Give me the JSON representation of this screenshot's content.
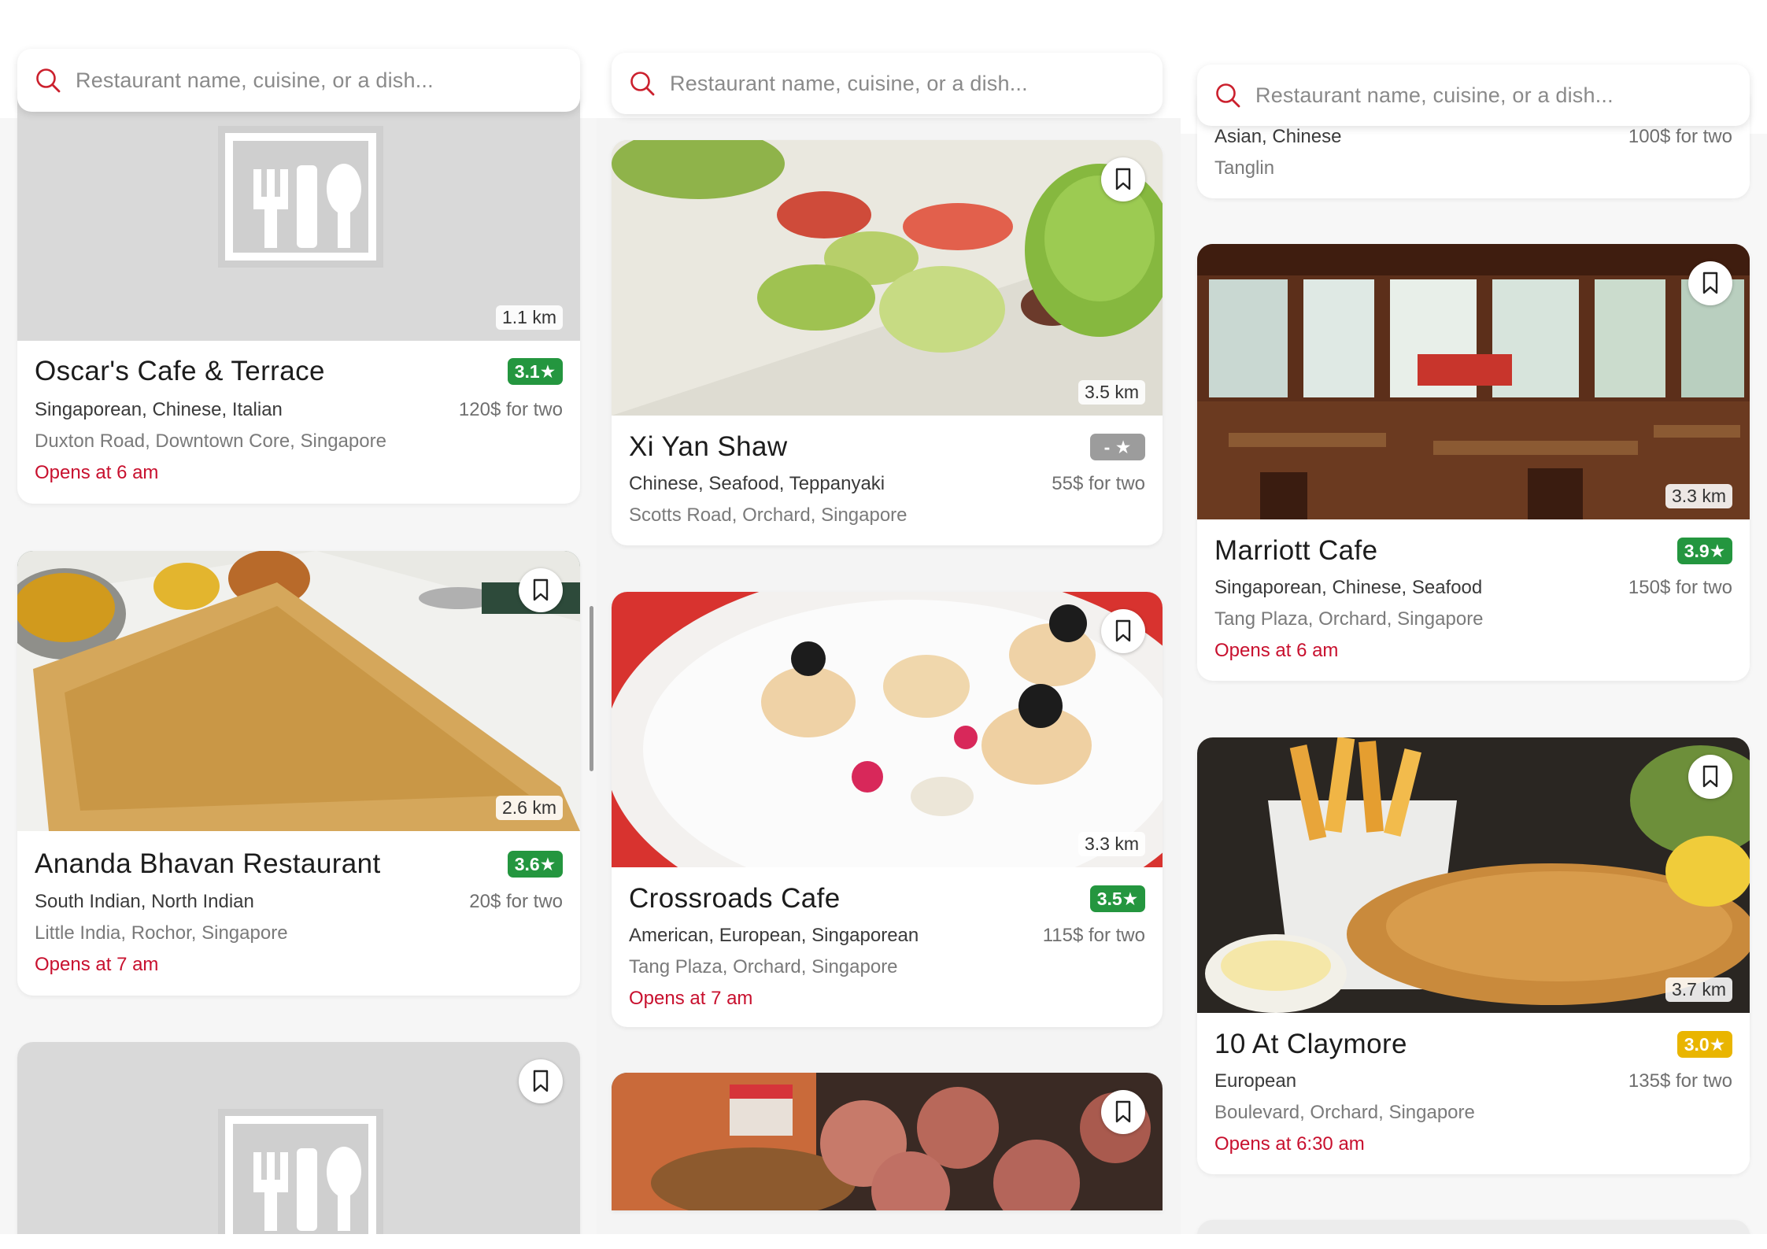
{
  "colors": {
    "accent_red": "#cb202d",
    "rating_green": "#24963f",
    "rating_gray": "#9c9c9c",
    "rating_yellow": "#e9b500"
  },
  "search": {
    "icon": "search-icon",
    "placeholder": "Restaurant name, cuisine, or a dish..."
  },
  "col1": {
    "oscar": {
      "distance": "1.1 km",
      "name": "Oscar's Cafe & Terrace",
      "rating": "3.1★",
      "cuisine": "Singaporean, Chinese, Italian",
      "price": "120$ for two",
      "location": "Duxton Road, Downtown Core, Singapore",
      "opens": "Opens at 6 am"
    },
    "ananda": {
      "distance": "2.6 km",
      "name": "Ananda Bhavan Restaurant",
      "rating": "3.6★",
      "cuisine": "South Indian, North Indian",
      "price": "20$ for two",
      "location": "Little India, Rochor, Singapore",
      "opens": "Opens at 7 am"
    }
  },
  "col2": {
    "xiyan": {
      "distance": "3.5 km",
      "name": "Xi Yan Shaw",
      "rating": "- ★",
      "cuisine": "Chinese, Seafood, Teppanyaki",
      "price": "55$ for two",
      "location": "Scotts Road, Orchard, Singapore"
    },
    "crossroads": {
      "distance": "3.3 km",
      "name": "Crossroads Cafe",
      "rating": "3.5★",
      "cuisine": "American, European, Singaporean",
      "price": "115$ for two",
      "location": "Tang Plaza, Orchard, Singapore",
      "opens": "Opens at 7 am"
    }
  },
  "col3": {
    "top_partial": {
      "cuisine": "Asian, Chinese",
      "price": "100$ for two",
      "location": "Tanglin"
    },
    "marriott": {
      "distance": "3.3 km",
      "name": "Marriott Cafe",
      "rating": "3.9★",
      "cuisine": "Singaporean, Chinese, Seafood",
      "price": "150$ for two",
      "location": "Tang Plaza, Orchard, Singapore",
      "opens": "Opens at 6 am"
    },
    "claymore": {
      "distance": "3.7 km",
      "name": "10 At Claymore",
      "rating": "3.0★",
      "cuisine": "European",
      "price": "135$ for two",
      "location": "Boulevard, Orchard, Singapore",
      "opens": "Opens at 6:30 am"
    }
  }
}
